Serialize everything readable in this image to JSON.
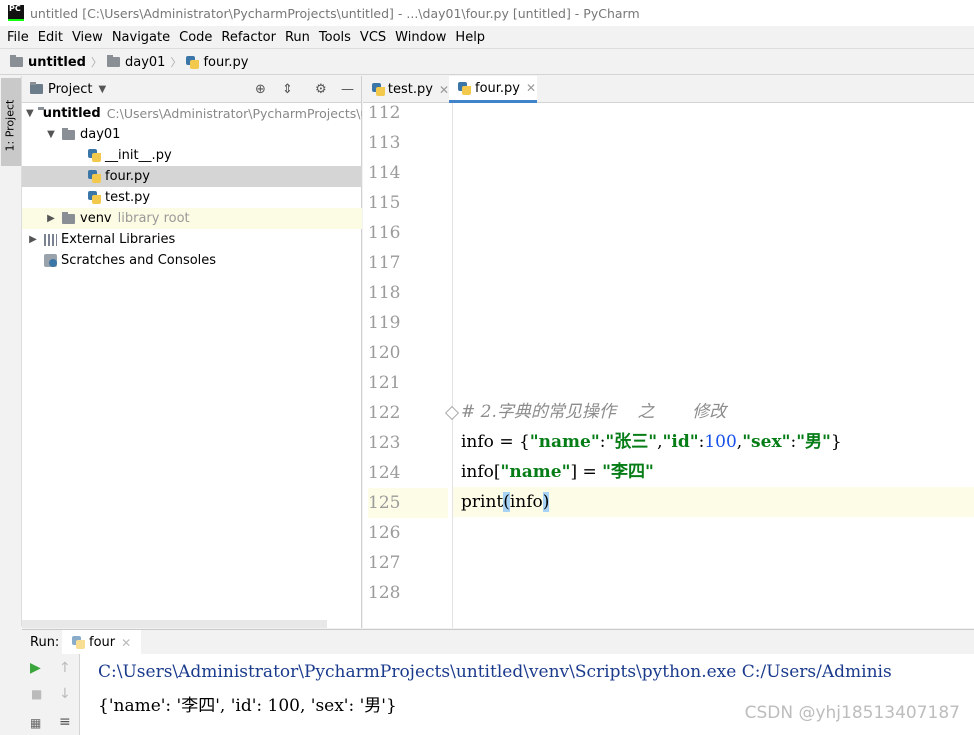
{
  "window": {
    "title": "untitled [C:\\Users\\Administrator\\PycharmProjects\\untitled] - ...\\day01\\four.py [untitled] - PyCharm",
    "app_icon_text": "PC"
  },
  "menu": [
    "File",
    "Edit",
    "View",
    "Navigate",
    "Code",
    "Refactor",
    "Run",
    "Tools",
    "VCS",
    "Window",
    "Help"
  ],
  "breadcrumb": {
    "project": "untitled",
    "folder": "day01",
    "file": "four.py"
  },
  "left_strip": {
    "project_tab": "1: Project"
  },
  "project_panel": {
    "header": "Project",
    "tree": [
      {
        "label": "untitled",
        "hint": "C:\\Users\\Administrator\\PycharmProjects\\u"
      },
      {
        "label": "day01"
      },
      {
        "label": "__init__.py"
      },
      {
        "label": "four.py"
      },
      {
        "label": "test.py"
      },
      {
        "label": "venv",
        "hint": "library root"
      },
      {
        "label": "External Libraries"
      },
      {
        "label": "Scratches and Consoles"
      }
    ]
  },
  "editor": {
    "tabs": [
      {
        "label": "test.py",
        "active": false
      },
      {
        "label": "four.py",
        "active": true
      }
    ],
    "line_numbers": [
      "112",
      "113",
      "114",
      "115",
      "116",
      "117",
      "118",
      "119",
      "120",
      "121",
      "122",
      "123",
      "124",
      "125",
      "126",
      "127",
      "128"
    ],
    "current_line": "125",
    "code": {
      "l122": "# 2.字典的常见操作    之       修改",
      "l123": {
        "p1": "info = {",
        "k1": "\"name\"",
        "c1": ":",
        "v1": "\"张三\"",
        "c2": ",",
        "k2": "\"id\"",
        "c3": ":",
        "v2": "100",
        "c4": ",",
        "k3": "\"sex\"",
        "c5": ":",
        "v3": "\"男\"",
        "p2": "}"
      },
      "l124": {
        "p1": "info[",
        "k1": "\"name\"",
        "p2": "] = ",
        "v1": "\"李四\""
      },
      "l125": {
        "p1": "print",
        "b1": "(",
        "p2": "info",
        "b2": ")"
      }
    }
  },
  "run": {
    "label": "Run:",
    "tab": "four",
    "output": [
      "C:\\Users\\Administrator\\PycharmProjects\\untitled\\venv\\Scripts\\python.exe C:/Users/Adminis",
      "{'name': '李四', 'id': 100, 'sex': '男'}"
    ]
  },
  "watermark": "CSDN @yhj18513407187",
  "colors": {
    "string": "#067d17",
    "number": "#1750eb",
    "comment": "#8c8c8c",
    "accent": "#4083c9",
    "current_line": "#fdfce6"
  }
}
